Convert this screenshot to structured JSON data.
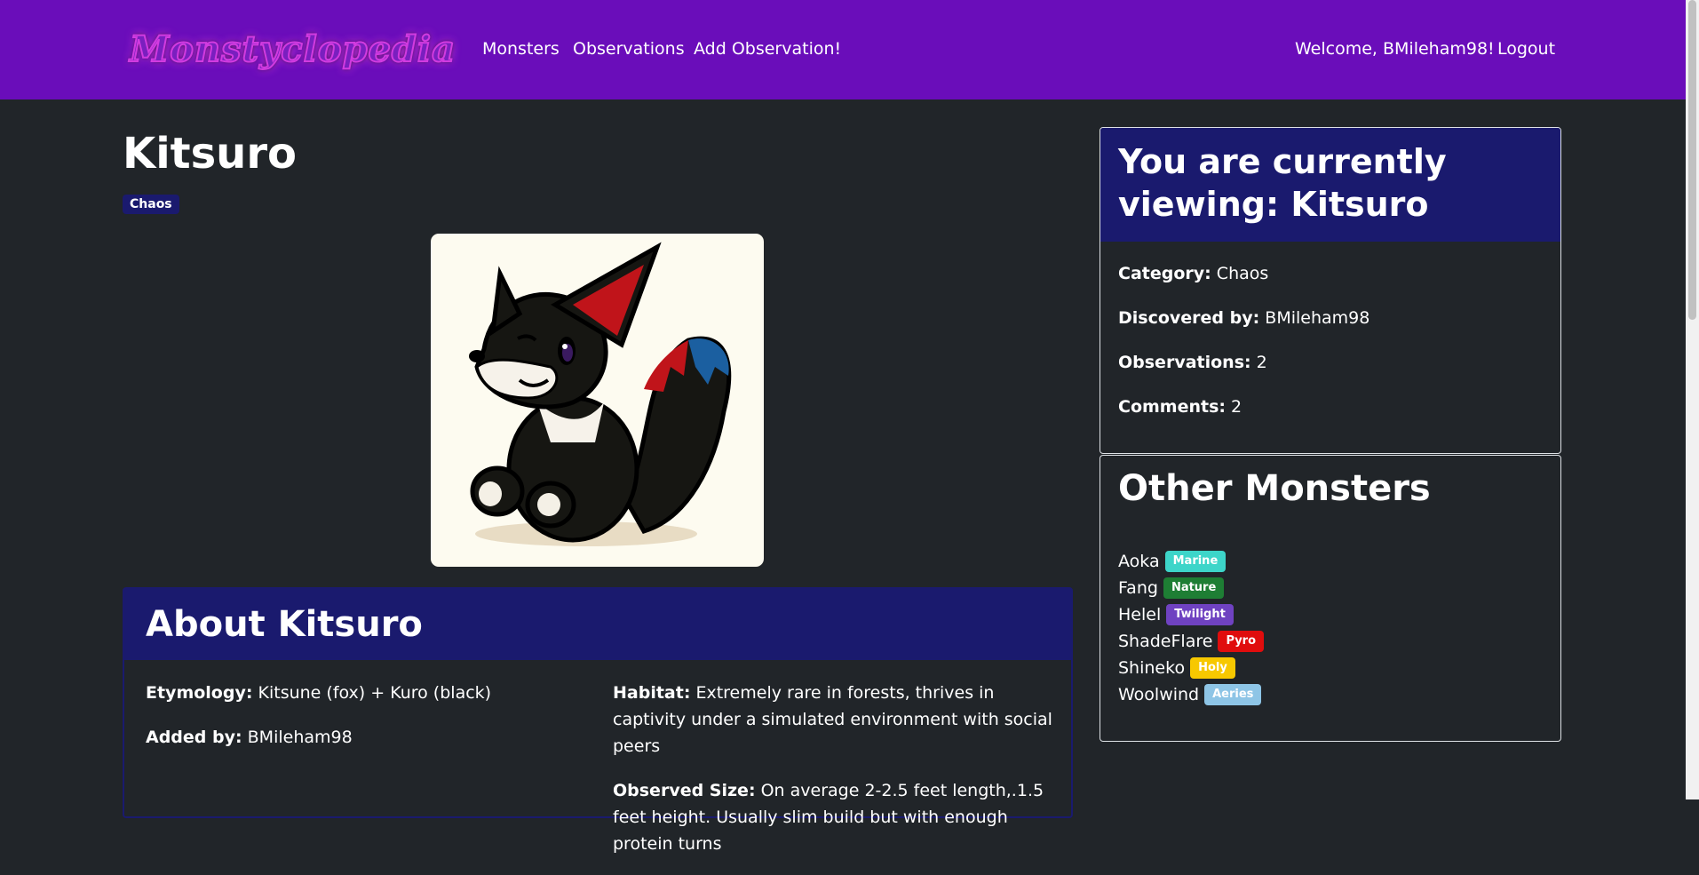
{
  "brand": {
    "name": "Monstyclopedia"
  },
  "nav": {
    "monsters": "Monsters",
    "observations": "Observations",
    "add_observation": "Add Observation!",
    "welcome": "Welcome, BMileham98!",
    "logout": "Logout"
  },
  "monster": {
    "name": "Kitsuro",
    "category_badge": "Chaos",
    "category_color": "#1a1a6e"
  },
  "about": {
    "title": "About Kitsuro",
    "etymology_label": "Etymology:",
    "etymology": "Kitsune (fox) + Kuro (black)",
    "added_by_label": "Added by:",
    "added_by": "BMileham98",
    "habitat_label": "Habitat:",
    "habitat": "Extremely rare in forests, thrives in captivity under a simulated environment with social peers",
    "size_label": "Observed Size:",
    "size": "On average 2-2.5 feet length,.1.5 feet height. Usually slim build but with enough protein turns"
  },
  "viewing": {
    "title": "You are currently viewing: Kitsuro",
    "category_label": "Category:",
    "category": "Chaos",
    "discovered_label": "Discovered by:",
    "discovered": "BMileham98",
    "observations_label": "Observations:",
    "observations": "2",
    "comments_label": "Comments:",
    "comments": "2"
  },
  "other_monsters": {
    "title": "Other Monsters",
    "items": [
      {
        "name": "Aoka",
        "badge": "Marine",
        "color": "#3dd5c9"
      },
      {
        "name": "Fang",
        "badge": "Nature",
        "color": "#1e7e34"
      },
      {
        "name": "Helel",
        "badge": "Twilight",
        "color": "#6f42c1"
      },
      {
        "name": "ShadeFlare",
        "badge": "Pyro",
        "color": "#e00d0d"
      },
      {
        "name": "Shineko",
        "badge": "Holy",
        "color": "#f7c800"
      },
      {
        "name": "Woolwind",
        "badge": "Aeries",
        "color": "#8ec5e6"
      }
    ]
  },
  "colors": {
    "navbar": "#6a0dba",
    "background": "#212529",
    "card_header": "#1a1a6e"
  }
}
